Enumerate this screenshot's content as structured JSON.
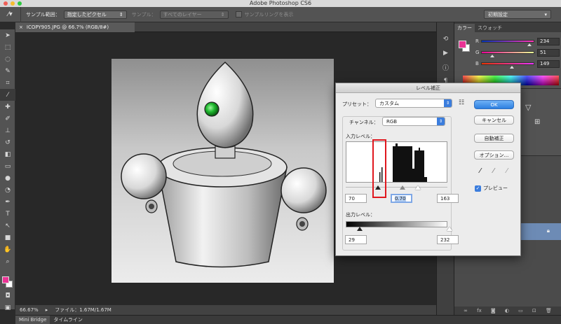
{
  "app": {
    "title": "Adobe Photoshop CS6"
  },
  "options_bar": {
    "sample_size_label": "サンプル範囲：",
    "sample_size_value": "指定したピクセル",
    "sample_label": "サンプル：",
    "sample_value": "すべてのレイヤー",
    "show_ring_label": "サンプルリングを表示",
    "workspace_value": "初期設定"
  },
  "document": {
    "tab_title": "ICOPY905.JPG @ 66.7% (RGB/8#)",
    "zoom": "66.67%",
    "file_info": "ファイル：1.67M/1.67M"
  },
  "bottom_tabs": [
    "Mini Bridge",
    "タイムライン"
  ],
  "color_panel": {
    "tabs": [
      "カラー",
      "スウォッチ"
    ],
    "channels": [
      {
        "name": "R",
        "value": "234",
        "fraction": 0.918
      },
      {
        "name": "G",
        "value": "51",
        "fraction": 0.2
      },
      {
        "name": "B",
        "value": "149",
        "fraction": 0.584
      }
    ],
    "foreground_color": "#ea3395",
    "background_color": "#ffffff"
  },
  "levels_dialog": {
    "title": "レベル補正",
    "preset_label": "プリセット：",
    "preset_value": "カスタム",
    "channel_label": "チャンネル：",
    "channel_value": "RGB",
    "input_levels_label": "入力レベル：",
    "input_black": "70",
    "input_gamma": "0.70",
    "input_white": "163",
    "output_levels_label": "出力レベル：",
    "output_black": "29",
    "output_white": "232",
    "buttons": {
      "ok": "OK",
      "cancel": "キャンセル",
      "auto": "自動補正",
      "options": "オプション..."
    },
    "preview_label": "プレビュー",
    "preview_checked": true
  },
  "colors": {
    "accent": "#3b7ddd",
    "highlight_box": "#e0171e",
    "eye_green": "#1fb82f"
  }
}
